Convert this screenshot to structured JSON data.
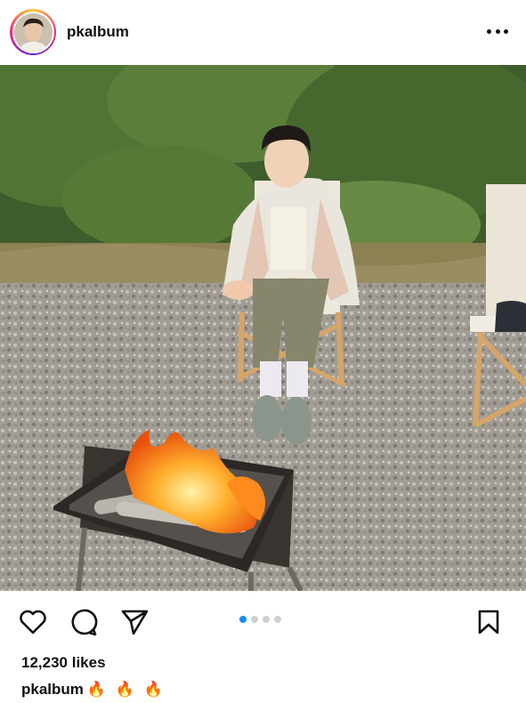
{
  "post": {
    "username": "pkalbum",
    "likes": "12,230 likes",
    "caption_user": "pkalbum",
    "caption_text": "🔥 🔥 🔥",
    "carousel": {
      "count": 4,
      "active_index": 0
    }
  },
  "icons": {
    "more": "more-horizontal-icon",
    "like": "heart-icon",
    "comment": "comment-bubble-icon",
    "share": "send-paper-plane-icon",
    "save": "bookmark-icon"
  },
  "colors": {
    "carousel_active": "#1a8ef0",
    "carousel_inactive": "#cfcfcf"
  }
}
